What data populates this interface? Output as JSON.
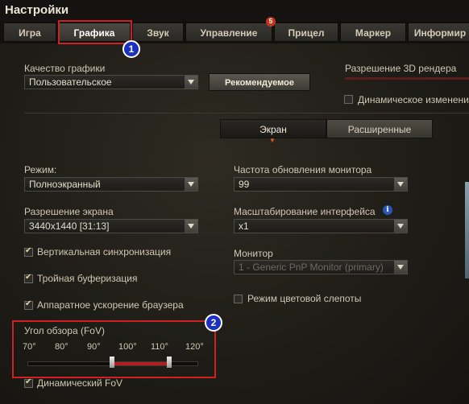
{
  "window": {
    "title": "Настройки"
  },
  "tabs": [
    {
      "label": "Игра"
    },
    {
      "label": "Графика"
    },
    {
      "label": "Звук"
    },
    {
      "label": "Управление"
    },
    {
      "label": "Прицел"
    },
    {
      "label": "Маркер"
    },
    {
      "label": "Информир"
    }
  ],
  "tab_badge": "5",
  "markers": [
    "1",
    "2"
  ],
  "graphics_quality": {
    "label": "Качество графики",
    "value": "Пользовательское",
    "recommended_button": "Рекомендуемое"
  },
  "render_resolution": {
    "label": "Разрешение 3D рендера",
    "dynamic_change_label": "Динамическое изменение",
    "dynamic_change_checked": false
  },
  "subtabs": {
    "screen": "Экран",
    "advanced": "Расширенные"
  },
  "left": {
    "mode": {
      "label": "Режим:",
      "value": "Полноэкранный"
    },
    "resolution": {
      "label": "Разрешение экрана",
      "value": "3440x1440 [31:13]"
    },
    "vsync": {
      "label": "Вертикальная синхронизация",
      "checked": true
    },
    "triple_buffering": {
      "label": "Тройная буферизация",
      "checked": true
    },
    "hw_accel": {
      "label": "Аппаратное ускорение браузера",
      "checked": true
    }
  },
  "right": {
    "refresh_rate": {
      "label": "Частота обновления монитора",
      "value": "99"
    },
    "ui_scale": {
      "label": "Масштабирование интерфейса",
      "value": "x1",
      "info_icon": "info-icon"
    },
    "monitor": {
      "label": "Монитор",
      "value": "1 - Generic PnP Monitor (primary)"
    },
    "colorblind": {
      "label": "Режим цветовой слепоты",
      "checked": false
    }
  },
  "fov": {
    "label": "Угол обзора (FoV)",
    "ticks": [
      "70°",
      "80°",
      "90°",
      "100°",
      "110°",
      "120°"
    ],
    "range_min": 70,
    "range_max": 120,
    "selected_low": 95,
    "selected_high": 112,
    "dynamic_fov": {
      "label": "Динамический FoV",
      "checked": true
    }
  }
}
